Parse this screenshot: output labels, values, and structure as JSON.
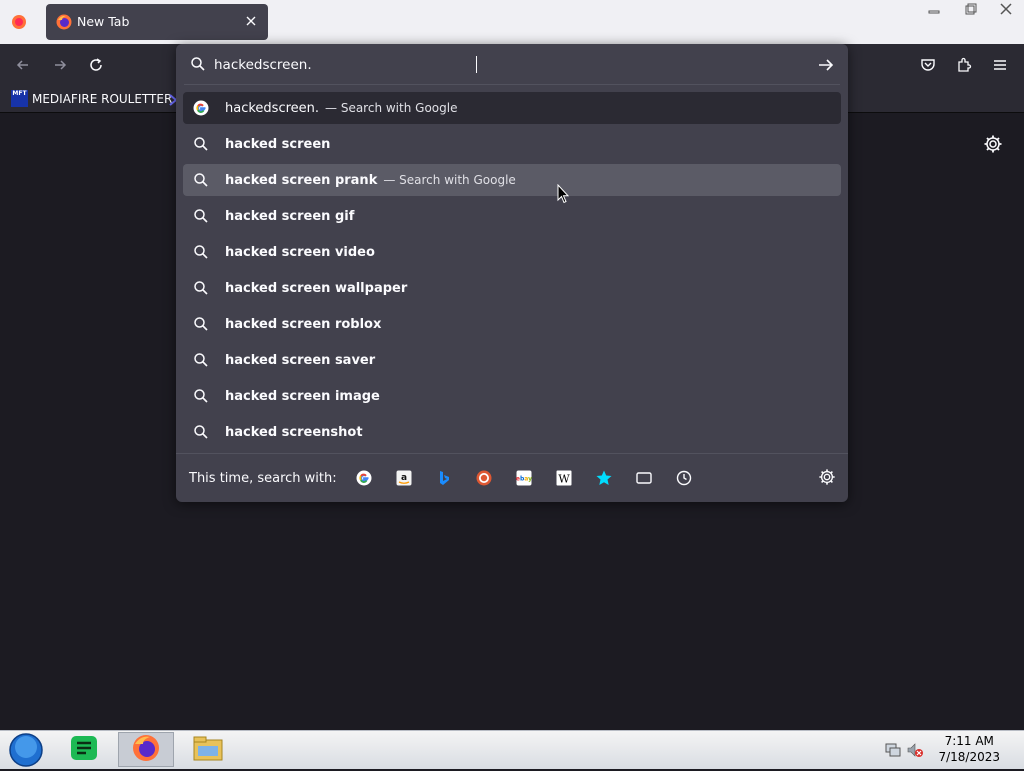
{
  "browser": {
    "tab_title": "New Tab",
    "bookmark_label": "MEDIAFIRE ROULETTER",
    "bookmark_icon_text": "MFT"
  },
  "url": {
    "value": "hackedscreen."
  },
  "suggestions": [
    {
      "text": "hackedscreen.",
      "action": "— Search with Google",
      "icon": "google-icon",
      "bold": false,
      "state": "selected"
    },
    {
      "text": "hacked screen",
      "action": "",
      "icon": "search-icon",
      "bold": true,
      "state": ""
    },
    {
      "text": "hacked screen prank",
      "action": "— Search with Google",
      "icon": "search-icon",
      "bold": true,
      "state": "hover"
    },
    {
      "text": "hacked screen gif",
      "action": "",
      "icon": "search-icon",
      "bold": true,
      "state": ""
    },
    {
      "text": "hacked screen video",
      "action": "",
      "icon": "search-icon",
      "bold": true,
      "state": ""
    },
    {
      "text": "hacked screen wallpaper",
      "action": "",
      "icon": "search-icon",
      "bold": true,
      "state": ""
    },
    {
      "text": "hacked screen roblox",
      "action": "",
      "icon": "search-icon",
      "bold": true,
      "state": ""
    },
    {
      "text": "hacked screen saver",
      "action": "",
      "icon": "search-icon",
      "bold": true,
      "state": ""
    },
    {
      "text": "hacked screen image",
      "action": "",
      "icon": "search-icon",
      "bold": true,
      "state": ""
    },
    {
      "text": "hacked screenshot",
      "action": "",
      "icon": "search-icon",
      "bold": true,
      "state": ""
    }
  ],
  "footer": {
    "label": "This time, search with:",
    "engines": [
      "google-icon",
      "amazon-icon",
      "bing-icon",
      "duckduckgo-icon",
      "ebay-icon",
      "wikipedia-icon",
      "bookmarks-star-icon",
      "tabs-icon",
      "history-icon"
    ]
  },
  "clock": {
    "time": "7:11 AM",
    "date": "7/18/2023"
  },
  "colors": {
    "panel": "#42414d",
    "toolbar": "#2b2a33",
    "page_bg": "#1c1b22",
    "hover_row": "#5b5b66"
  }
}
